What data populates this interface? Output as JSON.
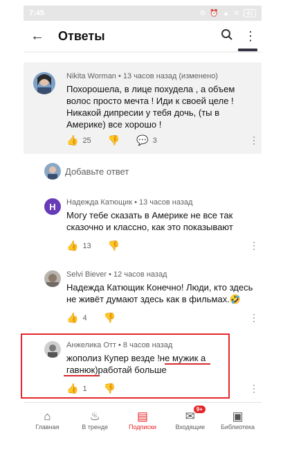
{
  "status": {
    "time": "7:45",
    "battery": "45"
  },
  "app_bar": {
    "title": "Ответы"
  },
  "top_comment": {
    "author": "Nikita Worman",
    "meta": "• 13 часов назад (изменено)",
    "text": "Похорошела, в лице похудела , а объем волос просто мечта ! Иди к своей целе ! Никакой дипресии у тебя дочь, (ты в Америке) все хорошо !",
    "likes": "25",
    "replies": "3"
  },
  "reply_box": {
    "placeholder": "Добавьте ответ"
  },
  "replies": [
    {
      "initial": "Н",
      "author": "Надежда Катющик",
      "meta": "• 13 часов назад",
      "text": "Могу тебе сказать в Америке не все так сказочно и классно, как это показывают",
      "likes": "13"
    },
    {
      "author": "Selvi Biever",
      "meta": "• 12 часов назад",
      "text": "Надежда Катющик Конечно! Люди, кто здесь не живёт думают здесь как в фильмах.🤣",
      "likes": "4"
    },
    {
      "author": "Анжелика Отт",
      "meta": "• 8 часов назад",
      "text": "жополиз Купер везде !не мужик а гавнюк)работай больше",
      "likes": "1"
    }
  ],
  "bottom_nav": {
    "home": "Главная",
    "trending": "В тренде",
    "subscriptions": "Подписки",
    "inbox": "Входящие",
    "inbox_badge": "9+",
    "library": "Библиотека"
  },
  "colors": {
    "accent": "#e5262b",
    "like_active": "#1565c0",
    "avatar_h": "#673ab7"
  }
}
